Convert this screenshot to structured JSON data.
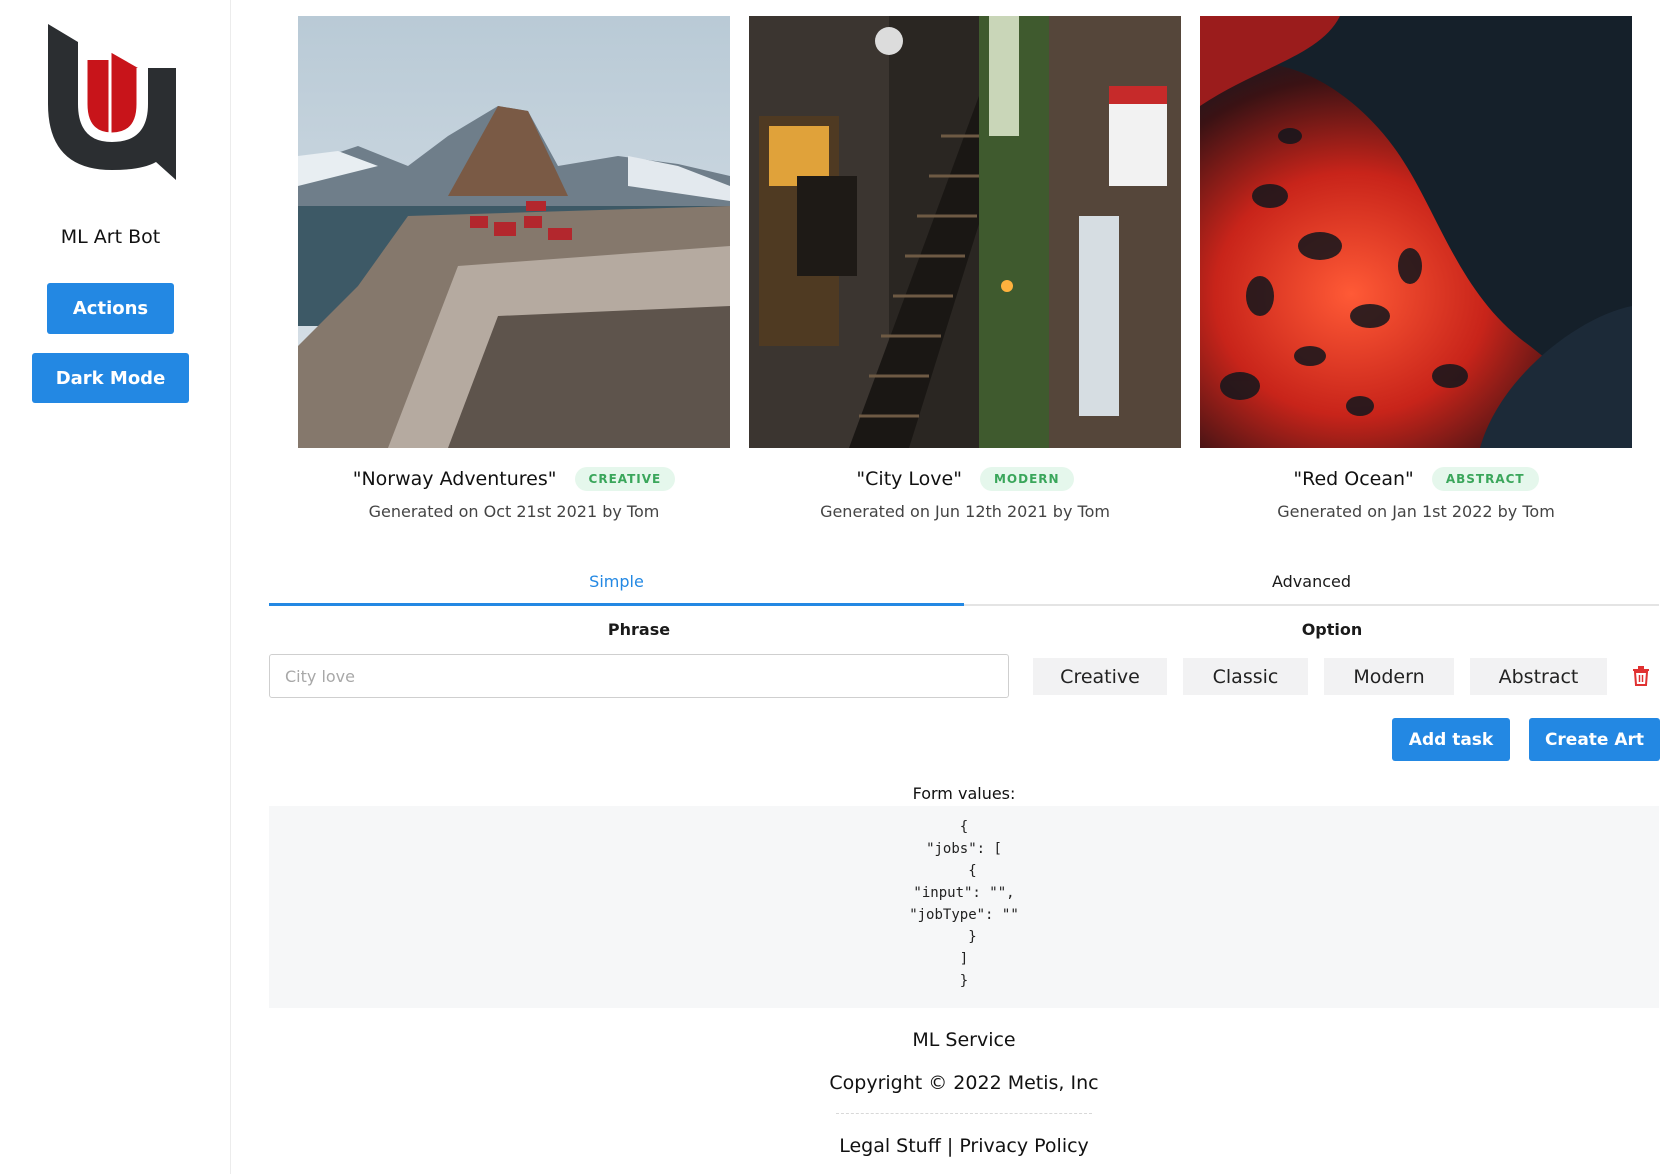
{
  "sidebar": {
    "app_name": "ML Art Bot",
    "actions_label": "Actions",
    "dark_mode_label": "Dark Mode"
  },
  "gallery": [
    {
      "title": "\"Norway Adventures\"",
      "tag": "CREATIVE",
      "caption": "Generated on Oct 21st 2021 by Tom"
    },
    {
      "title": "\"City Love\"",
      "tag": "MODERN",
      "caption": "Generated on Jun 12th 2021 by Tom"
    },
    {
      "title": "\"Red Ocean\"",
      "tag": "ABSTRACT",
      "caption": "Generated on Jan 1st 2022 by Tom"
    }
  ],
  "tabs": [
    {
      "label": "Simple",
      "active": true
    },
    {
      "label": "Advanced",
      "active": false
    }
  ],
  "form": {
    "phrase_heading": "Phrase",
    "option_heading": "Option",
    "phrase_placeholder": "City love",
    "options": [
      "Creative",
      "Classic",
      "Modern",
      "Abstract"
    ],
    "add_task_label": "Add task",
    "create_art_label": "Create Art",
    "values_label": "Form values:",
    "values_json": "{\n\"jobs\": [\n  {\n\"input\": \"\",\n\"jobType\": \"\"\n  }\n]\n}"
  },
  "footer": {
    "service": "ML Service",
    "copyright": "Copyright © 2022 Metis, Inc",
    "legal": "Legal Stuff",
    "separator": "|",
    "privacy": "Privacy Policy"
  },
  "colors": {
    "primary": "#2388e3",
    "badge_bg": "#e5f7ec",
    "badge_text": "#3aa65b",
    "delete_red": "#e03131",
    "logo_dark": "#2b2e31",
    "logo_red": "#c8141a"
  },
  "icons": {
    "logo": "ml-art-bot-logo",
    "delete": "trash-icon"
  }
}
